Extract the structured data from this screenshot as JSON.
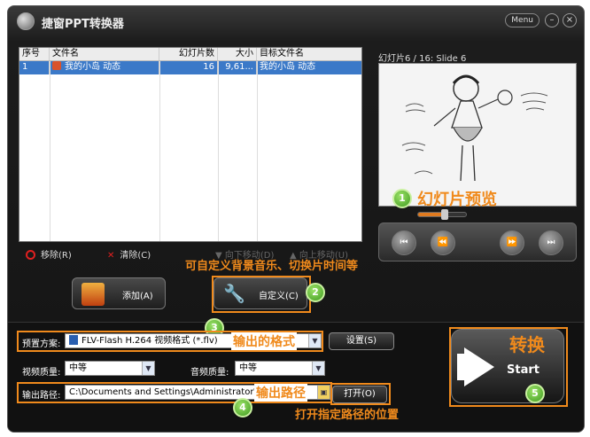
{
  "window": {
    "title": "捷窗PPT转换器",
    "menu_label": "Menu",
    "minimize": "–",
    "close": "×"
  },
  "file_list": {
    "columns": [
      "序号",
      "文件名",
      "幻灯片数",
      "大小",
      "目标文件名"
    ],
    "rows": [
      {
        "no": "1",
        "name": "我的小岛 动态",
        "slides": "16",
        "size": "9,61...",
        "target": "我的小岛 动态"
      }
    ]
  },
  "list_toolbar": {
    "remove": "移除(R)",
    "clear": "清除(C)",
    "move_down": "向下移动(D)",
    "move_up": "向上移动(U)"
  },
  "preview": {
    "label": "幻灯片6 / 16: Slide 6",
    "slider_value": 0.55,
    "annotation": "幻灯片预览",
    "badge": "1"
  },
  "player": {
    "first": "⏮",
    "rewind": "⏪",
    "forward": "⏩",
    "last": "⏭"
  },
  "buttons": {
    "add": "添加(A)",
    "customize": "自定义(C)"
  },
  "annotations": {
    "customize_note": "可自定义背景音乐、切换片时间等",
    "format_note": "输出的格式",
    "path_note": "输出路径",
    "open_note": "打开指定路径的位置",
    "convert_note": "转换"
  },
  "badges": {
    "b2": "2",
    "b3": "3",
    "b4": "4",
    "b5": "5"
  },
  "settings": {
    "preset_label": "预置方案:",
    "preset_value": "FLV-Flash H.264 视频格式 (*.flv)",
    "settings_button": "设置(S)",
    "video_quality_label": "视频质量:",
    "video_quality_value": "中等",
    "audio_quality_label": "音频质量:",
    "audio_quality_value": "中等",
    "output_label": "输出路径:",
    "output_value": "C:\\Documents and Settings\\Administrator\\桌面",
    "open_button": "打开(O)"
  },
  "start": {
    "label": "Start"
  },
  "colors": {
    "annotation": "#f08a1c",
    "selection": "#3b79c8",
    "badge": "#3e9a1e"
  }
}
